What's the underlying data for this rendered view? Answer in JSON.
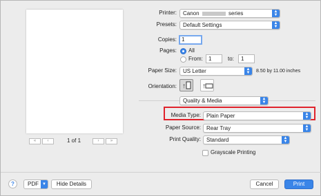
{
  "printer": {
    "label": "Printer:",
    "value_prefix": "Canon",
    "value_suffix": "series"
  },
  "presets": {
    "label": "Presets:",
    "value": "Default Settings"
  },
  "copies": {
    "label": "Copies:",
    "value": "1"
  },
  "pages": {
    "label": "Pages:",
    "all_label": "All",
    "from_label": "From:",
    "from_value": "1",
    "to_label": "to:",
    "to_value": "1"
  },
  "paper_size": {
    "label": "Paper Size:",
    "value": "US Letter",
    "dimensions": "8.50 by 11.00 inches"
  },
  "orientation": {
    "label": "Orientation:"
  },
  "panel": {
    "value": "Quality & Media"
  },
  "media_type": {
    "label": "Media Type:",
    "value": "Plain Paper"
  },
  "paper_source": {
    "label": "Paper Source:",
    "value": "Rear Tray"
  },
  "print_quality": {
    "label": "Print Quality:",
    "value": "Standard"
  },
  "grayscale": {
    "label": "Grayscale Printing",
    "checked": false
  },
  "preview_nav": {
    "page_indicator": "1 of 1"
  },
  "footer": {
    "help": "?",
    "pdf_label": "PDF",
    "hide_details_label": "Hide Details",
    "cancel_label": "Cancel",
    "print_label": "Print"
  },
  "colors": {
    "accent": "#3a85e8",
    "highlight_border": "#e0222b"
  }
}
